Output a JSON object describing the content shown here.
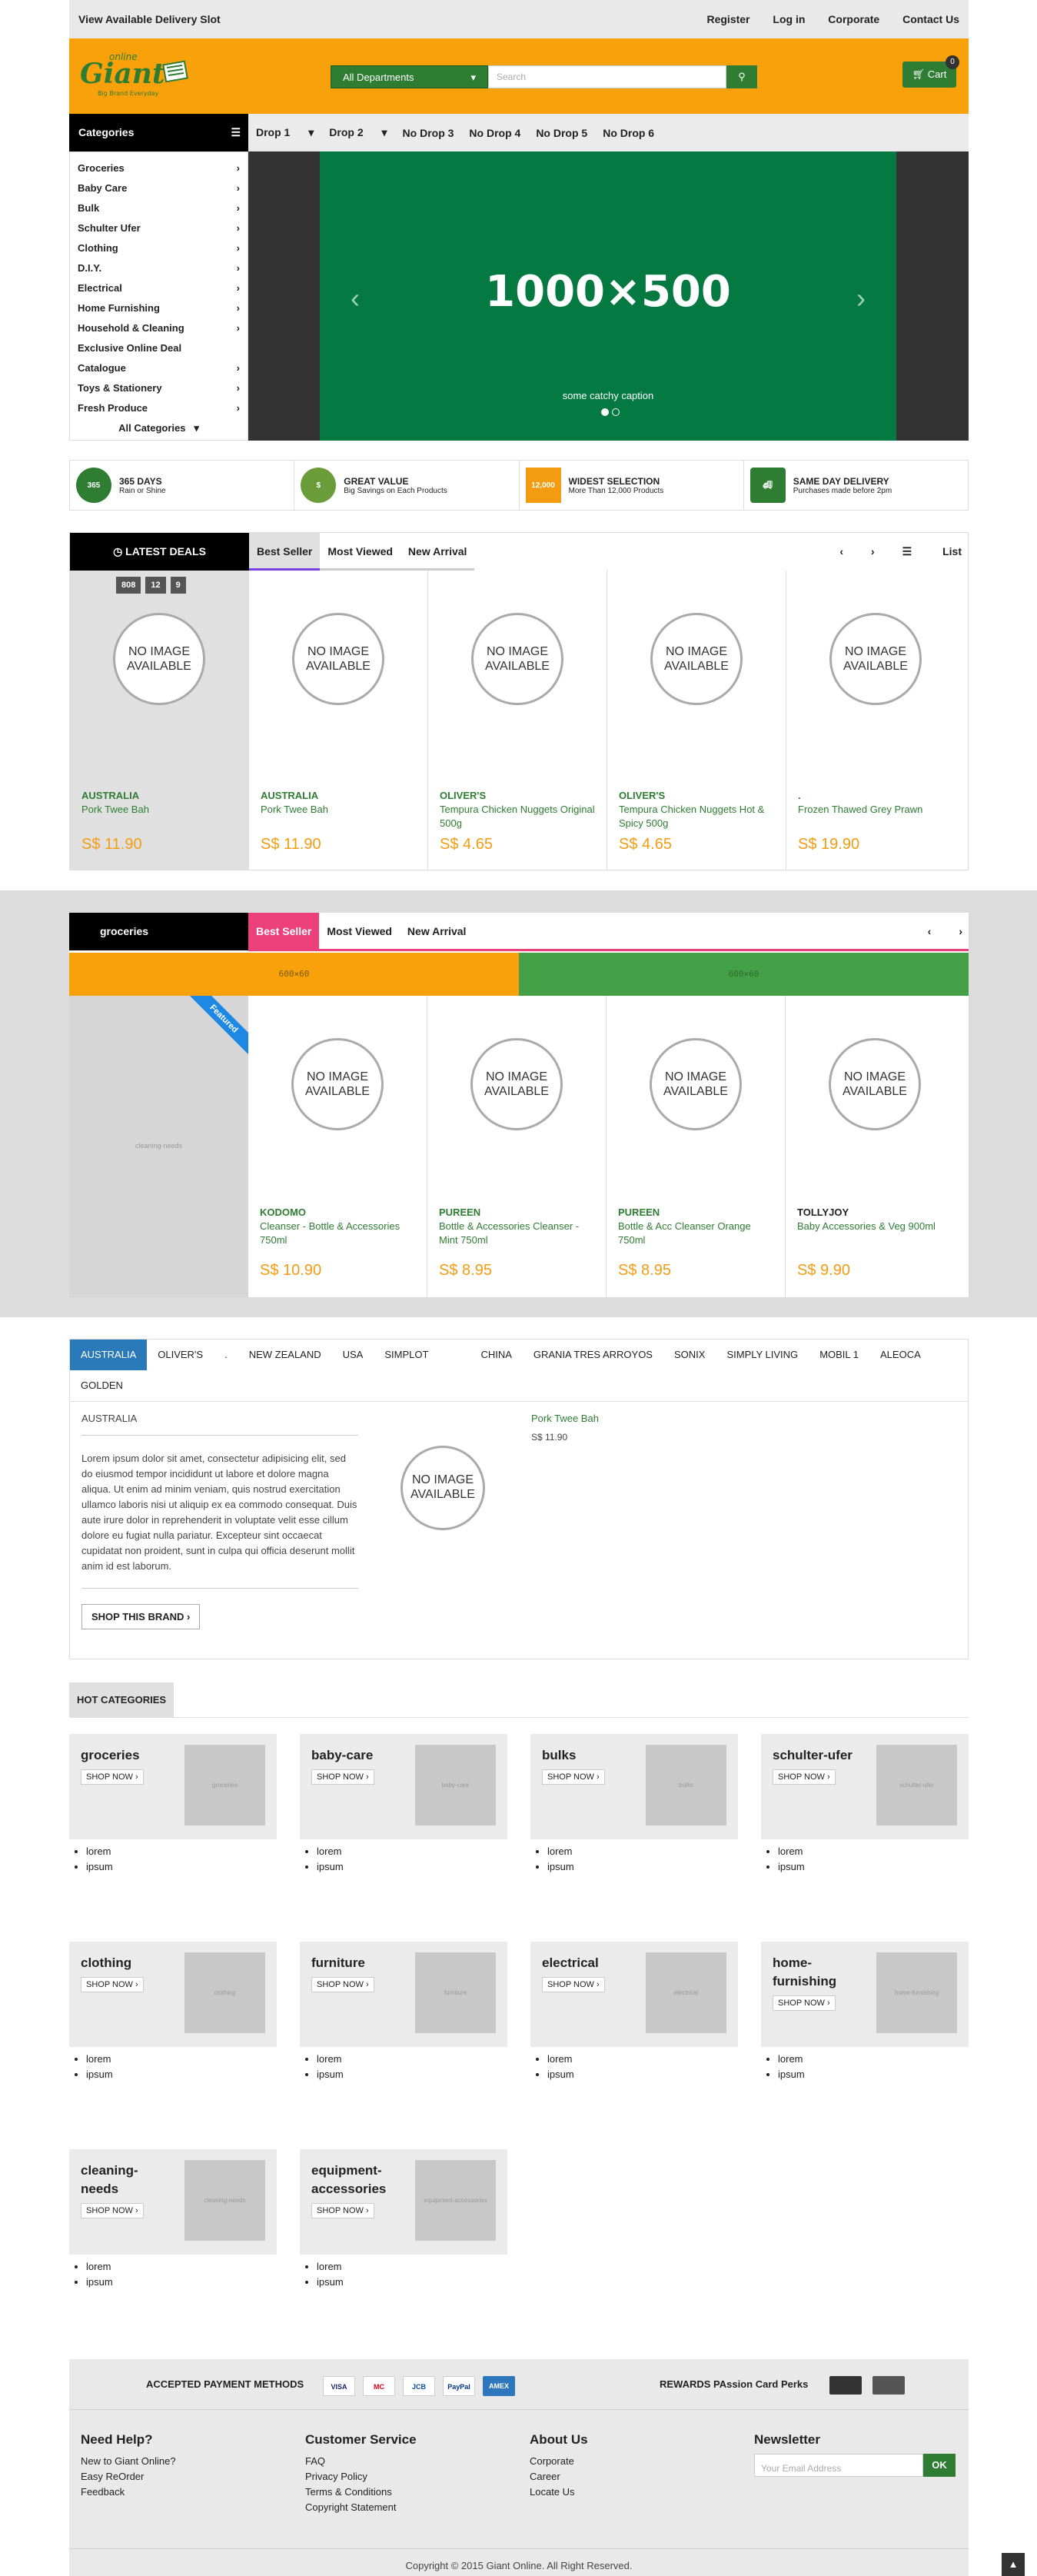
{
  "topbar": {
    "left": "View Available Delivery Slot",
    "links": [
      "Register",
      "Log in",
      "Corporate",
      "Contact Us"
    ]
  },
  "header": {
    "logo_top": "online",
    "logo_main": "Giant",
    "logo_sub": "Big Brand Everyday",
    "dept": "All Departments",
    "search_placeholder": "Search",
    "cart": "Cart",
    "cart_count": "0"
  },
  "nav": {
    "categories": "Categories",
    "drops": [
      "Drop 1",
      "Drop 2",
      "No Drop 3",
      "No Drop 4",
      "No Drop 5",
      "No Drop 6"
    ]
  },
  "sidemenu": [
    "Groceries",
    "Baby Care",
    "Bulk",
    "Schulter Ufer",
    "Clothing",
    "D.I.Y.",
    "Electrical",
    "Home Furnishing",
    "Household & Cleaning",
    "Exclusive Online Deal",
    "Catalogue",
    "Toys & Stationery",
    "Fresh Produce"
  ],
  "sidemenu_all": "All Categories",
  "slider": {
    "text": "1000×500",
    "caption": "some catchy caption"
  },
  "features": [
    {
      "icon": "365",
      "t1": "365 DAYS",
      "t2": "Rain or Shine",
      "color": "#2e7d32"
    },
    {
      "icon": "$",
      "t1": "GREAT VALUE",
      "t2": "Big Savings on Each Products",
      "color": "#6a9c3a"
    },
    {
      "icon": "12,000",
      "t1": "WIDEST SELECTION",
      "t2": "More Than 12,000 Products",
      "color": "#f39c12"
    },
    {
      "icon": "truck",
      "t1": "SAME DAY DELIVERY",
      "t2": "Purchases made before 2pm",
      "color": "#2e7d32"
    }
  ],
  "deals": {
    "title": "LATEST DEALS",
    "tabs": [
      "Best Seller",
      "Most Viewed",
      "New Arrival"
    ],
    "list": "List",
    "counter": [
      "808",
      "12",
      "9"
    ],
    "noimg": "NO IMAGE AVAILABLE",
    "products": [
      {
        "brand": "AUSTRALIA",
        "name": "Pork Twee Bah",
        "price": "S$ 11.90"
      },
      {
        "brand": "AUSTRALIA",
        "name": "Pork Twee Bah",
        "price": "S$ 11.90"
      },
      {
        "brand": "OLIVER'S",
        "name": "Tempura Chicken Nuggets Original 500g",
        "price": "S$ 4.65"
      },
      {
        "brand": "OLIVER'S",
        "name": "Tempura Chicken Nuggets Hot & Spicy 500g",
        "price": "S$ 4.65"
      },
      {
        "brand": ".",
        "name": "Frozen Thawed Grey Prawn",
        "price": "S$ 19.90"
      }
    ]
  },
  "groceries": {
    "title": "groceries",
    "tabs": [
      "Best Seller",
      "Most Viewed",
      "New Arrival"
    ],
    "banner": "600×60",
    "featured_img": "cleaning-needs",
    "ribbon": "Featured",
    "products": [
      {
        "brand": "KODOMO",
        "name": "Cleanser - Bottle & Accessories 750ml",
        "price": "S$ 10.90"
      },
      {
        "brand": "PUREEN",
        "name": "Bottle & Accessories Cleanser - Mint 750ml",
        "price": "S$ 8.95"
      },
      {
        "brand": "PUREEN",
        "name": "Bottle & Acc Cleanser Orange 750ml",
        "price": "S$ 8.95"
      },
      {
        "brand": "TOLLYJOY",
        "name": "Baby Accessories & Veg 900ml",
        "price": "S$ 9.90"
      }
    ]
  },
  "brands": {
    "tabs": [
      "AUSTRALIA",
      "OLIVER'S",
      ".",
      "NEW ZEALAND",
      "USA",
      "SIMPLOT",
      "",
      "CHINA",
      "GRANIA TRES ARROYOS",
      "SONIX",
      "SIMPLY LIVING",
      "MOBIL 1",
      "ALEOCA",
      "GOLDEN"
    ],
    "name": "AUSTRALIA",
    "text": "Lorem ipsum dolor sit amet, consectetur adipisicing elit, sed do eiusmod tempor incididunt ut labore et dolore magna aliqua. Ut enim ad minim veniam, quis nostrud exercitation ullamco laboris nisi ut aliquip ex ea commodo consequat. Duis aute irure dolor in reprehenderit in voluptate velit esse cillum dolore eu fugiat nulla pariatur. Excepteur sint occaecat cupidatat non proident, sunt in culpa qui officia deserunt mollit anim id est laborum.",
    "button": "SHOP THIS BRAND",
    "product": {
      "name": "Pork Twee Bah",
      "price": "S$ 11.90"
    }
  },
  "hot": {
    "title": "HOT CATEGORIES",
    "shop": "SHOP NOW",
    "items_list": [
      "lorem",
      "ipsum"
    ],
    "cats": [
      {
        "name": "groceries",
        "img": "groceries"
      },
      {
        "name": "baby-care",
        "img": "baby-care"
      },
      {
        "name": "bulks",
        "img": "bulks"
      },
      {
        "name": "schulter-ufer",
        "img": "schulter-ufer"
      },
      {
        "name": "clothing",
        "img": "clothing"
      },
      {
        "name": "furniture",
        "img": "furniture"
      },
      {
        "name": "electrical",
        "img": "electrical"
      },
      {
        "name": "home-furnishing",
        "img": "home-furnishing"
      },
      {
        "name": "cleaning-needs",
        "img": "cleaning-needs"
      },
      {
        "name": "equipment-accessories",
        "img": "equipment-accessories"
      }
    ]
  },
  "footer": {
    "payment": "ACCEPTED PAYMENT METHODS",
    "cards": [
      {
        "n": "VISA",
        "bg": "#fff",
        "fg": "#1a1f71"
      },
      {
        "n": "MC",
        "bg": "#fff",
        "fg": "#eb001b"
      },
      {
        "n": "JCB",
        "bg": "#fff",
        "fg": "#0b4ea2"
      },
      {
        "n": "PayPal",
        "bg": "#fff",
        "fg": "#003087"
      },
      {
        "n": "AMEX",
        "bg": "#2e77bc",
        "fg": "#fff"
      }
    ],
    "rewards": "REWARDS PAssion Card Perks",
    "cols": [
      {
        "h": "Need Help?",
        "items": [
          "New to Giant Online?",
          "Easy ReOrder",
          "Feedback"
        ]
      },
      {
        "h": "Customer Service",
        "items": [
          "FAQ",
          "Privacy Policy",
          "Terms & Conditions",
          "Copyright Statement"
        ]
      },
      {
        "h": "About Us",
        "items": [
          "Corporate",
          "Career",
          "Locate Us"
        ]
      }
    ],
    "newsletter": "Newsletter",
    "email_placeholder": "Your Email Address",
    "ok": "OK",
    "copyright": "Copyright © 2015 Giant Online. All Right Reserved."
  }
}
